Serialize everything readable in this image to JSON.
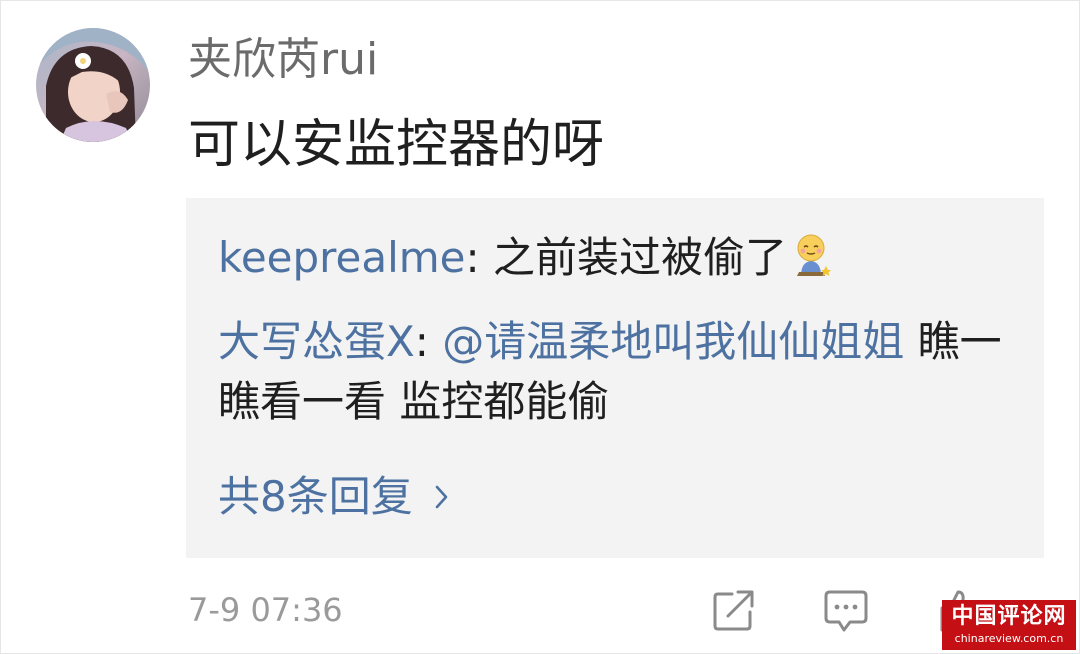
{
  "comment": {
    "username": "夹欣芮rui",
    "text": "可以安监控器的呀",
    "timestamp": "7-9 07:36"
  },
  "replies": [
    {
      "author": "keeprealme",
      "separator": ": ",
      "text": "之前装过被偷了",
      "emoji": "emoji-icon"
    },
    {
      "author": "大写怂蛋X",
      "separator": ": ",
      "mention": "@请温柔地叫我仙仙姐姐",
      "text": " 瞧一瞧看一看 监控都能偷"
    }
  ],
  "more_replies_label": "共8条回复",
  "icons": {
    "share": "share-icon",
    "comment": "comment-icon",
    "like": "like-icon",
    "chevron": "chevron-right-icon"
  },
  "colors": {
    "link": "#4d72a1",
    "reply_bg": "#f3f3f3",
    "muted_text": "#9a9a9a",
    "watermark_bg": "#c40f15"
  },
  "watermark": {
    "main": "中国评论网",
    "sub": "chinareview.com.cn"
  }
}
